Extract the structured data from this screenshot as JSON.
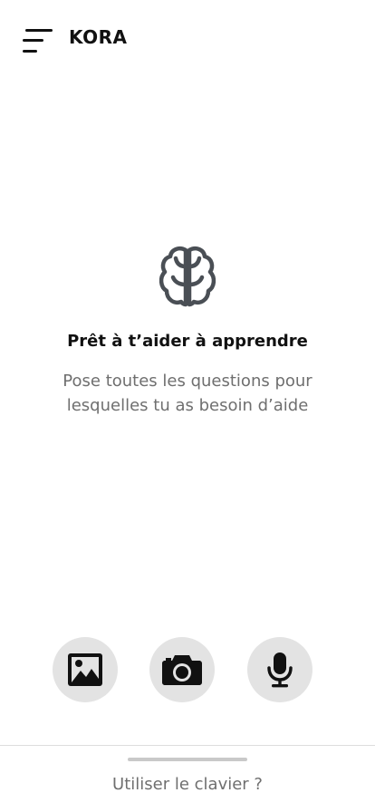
{
  "header": {
    "title": "KORA",
    "menu_icon": "hamburger-menu-icon"
  },
  "empty_state": {
    "icon": "brain-icon",
    "title": "Prêt à t’aider à apprendre",
    "subtitle": "Pose toutes les questions pour lesquelles tu as besoin d’aide"
  },
  "actions": [
    {
      "icon": "image-icon"
    },
    {
      "icon": "camera-icon"
    },
    {
      "icon": "microphone-icon"
    }
  ],
  "footer": {
    "keyboard_label": "Utiliser le clavier ?"
  },
  "colors": {
    "text": "#111111",
    "muted_text": "#6f6f6f",
    "icon": "#4a4f55",
    "button_bg": "#e3e3e3",
    "divider": "#dddddd",
    "handle": "#c9c9c9"
  }
}
